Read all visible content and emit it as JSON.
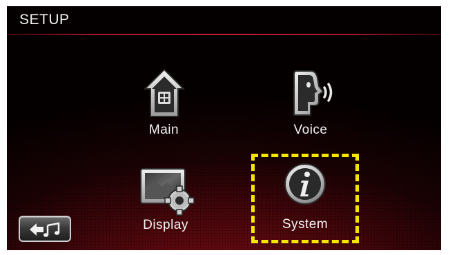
{
  "header": {
    "title": "SETUP"
  },
  "menu": {
    "items": [
      {
        "id": "main",
        "label": "Main",
        "icon": "home-icon"
      },
      {
        "id": "voice",
        "label": "Voice",
        "icon": "voice-icon"
      },
      {
        "id": "display",
        "label": "Display",
        "icon": "display-settings-icon"
      },
      {
        "id": "system",
        "label": "System",
        "icon": "info-icon"
      }
    ],
    "selected": "System"
  },
  "footer": {
    "back_icon": "back-music-icon"
  },
  "colors": {
    "accent_rule": "#c0202a",
    "focus_highlight": "#f5e600",
    "label_text": "#f5f5f5"
  }
}
